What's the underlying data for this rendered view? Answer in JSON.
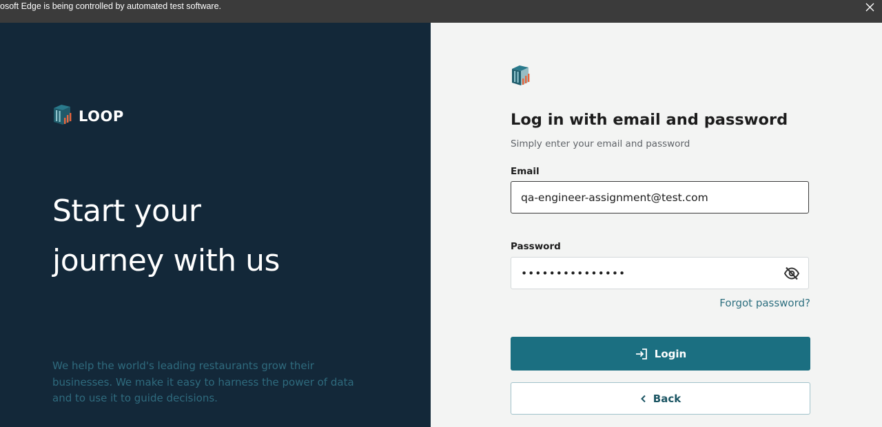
{
  "browser": {
    "infobar_text": "osoft Edge is being controlled by automated test software."
  },
  "left": {
    "brand_name": "LOOP",
    "headline_line1": "Start your",
    "headline_line2": "journey with us",
    "tagline": "We help the world's leading restaurants grow their businesses. We make it easy to harness the power of data and to use it to guide decisions."
  },
  "form": {
    "title": "Log in with email and password",
    "subtitle": "Simply enter your email and password",
    "email": {
      "label": "Email",
      "value": "qa-engineer-assignment@test.com"
    },
    "password": {
      "label": "Password",
      "value": "•••••••••••••••"
    },
    "forgot_label": "Forgot password?",
    "login_label": "Login",
    "back_label": "Back"
  },
  "icons": {
    "infobar_close": "close-icon",
    "brand_logo": "loop-logo-icon",
    "form_logo": "loop-logo-icon",
    "password_toggle": "eye-off-icon",
    "login": "login-arrow-icon",
    "back": "chevron-left-icon"
  },
  "colors": {
    "left_panel_bg": "#132839",
    "right_panel_bg": "#f3f4f3",
    "primary_button": "#1b6f81",
    "link": "#2d6f7f",
    "tagline": "#2f6b7e",
    "logo_teal": "#2a7a8c",
    "logo_orange": "#e8663d"
  }
}
